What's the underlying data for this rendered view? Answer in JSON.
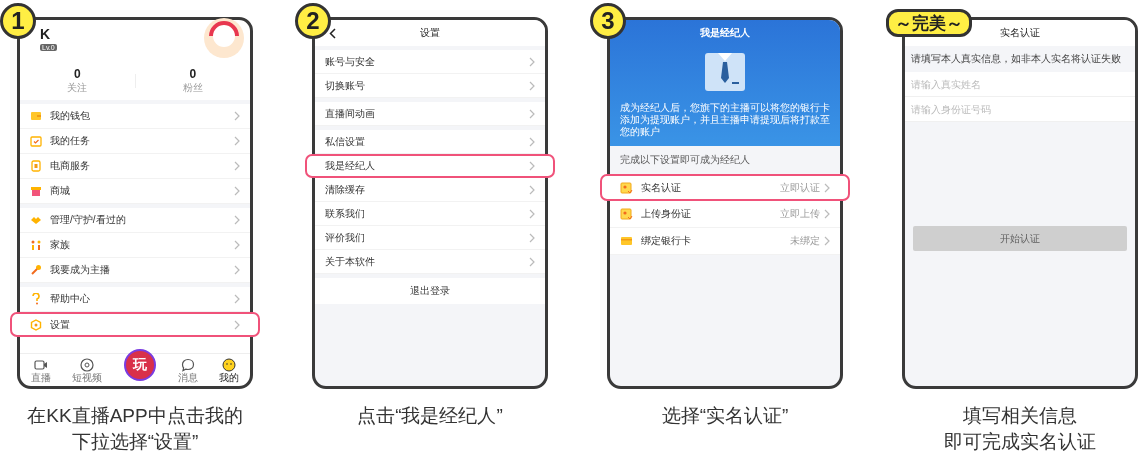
{
  "steps": [
    {
      "badge": {
        "kind": "number",
        "text": "1"
      },
      "screen": {
        "kind": "profile",
        "user": {
          "name": "K",
          "level": "Lv.0"
        },
        "stats": [
          {
            "value": "0",
            "label": "关注"
          },
          {
            "value": "0",
            "label": "粉丝"
          }
        ],
        "menu_groups": [
          [
            {
              "label": "我的钱包",
              "highlighted": false
            },
            {
              "label": "我的任务",
              "highlighted": false
            },
            {
              "label": "电商服务",
              "highlighted": false
            },
            {
              "label": "商城",
              "highlighted": false
            }
          ],
          [
            {
              "label": "管理/守护/看过的",
              "highlighted": false
            },
            {
              "label": "家族",
              "highlighted": false
            },
            {
              "label": "我要成为主播",
              "highlighted": false
            }
          ],
          [
            {
              "label": "帮助中心",
              "highlighted": false
            },
            {
              "label": "设置",
              "highlighted": true
            }
          ]
        ],
        "tab_bar": [
          {
            "kind": "tab",
            "label": "直播",
            "selected": false
          },
          {
            "kind": "tab",
            "label": "短视频",
            "selected": false
          },
          {
            "kind": "center",
            "label": "玩",
            "selected": false
          },
          {
            "kind": "tab",
            "label": "消息",
            "selected": false
          },
          {
            "kind": "tab",
            "label": "我的",
            "selected": true
          }
        ]
      },
      "caption": [
        "在KK直播APP中点击我的",
        "下拉选择“设置”"
      ]
    },
    {
      "badge": {
        "kind": "number",
        "text": "2"
      },
      "screen": {
        "kind": "settings",
        "title": "设置",
        "menu_groups": [
          [
            {
              "label": "账号与安全",
              "highlighted": false
            },
            {
              "label": "切换账号",
              "highlighted": false
            }
          ],
          [
            {
              "label": "直播间动画",
              "highlighted": false
            }
          ],
          [
            {
              "label": "私信设置",
              "highlighted": false
            },
            {
              "label": "我是经纪人",
              "highlighted": true
            },
            {
              "label": "清除缓存",
              "highlighted": false
            },
            {
              "label": "联系我们",
              "highlighted": false
            },
            {
              "label": "评价我们",
              "highlighted": false
            },
            {
              "label": "关于本软件",
              "highlighted": false
            }
          ]
        ],
        "logout": "退出登录"
      },
      "caption": [
        "点击“我是经纪人”"
      ]
    },
    {
      "badge": {
        "kind": "number",
        "text": "3"
      },
      "screen": {
        "kind": "agent",
        "title": "我是经纪人",
        "description": "成为经纪人后，您旗下的主播可以将您的银行卡添加为提现账户，并且主播申请提现后将打款至您的账户",
        "section_label": "完成以下设置即可成为经纪人",
        "tasks": [
          {
            "label": "实名认证",
            "status": "立即认证",
            "highlighted": true
          },
          {
            "label": "上传身份证",
            "status": "立即上传",
            "highlighted": false
          },
          {
            "label": "绑定银行卡",
            "status": "未绑定",
            "highlighted": false
          }
        ]
      },
      "caption": [
        "选择“实名认证”"
      ]
    },
    {
      "badge": {
        "kind": "pill",
        "text": "～完美～"
      },
      "screen": {
        "kind": "verify",
        "title": "实名认证",
        "notice": "请填写本人真实信息，如非本人实名将认证失败",
        "fields": [
          {
            "placeholder": "请输入真实姓名"
          },
          {
            "placeholder": "请输入身份证号码"
          }
        ],
        "submit": {
          "label": "开始认证",
          "disabled": true
        }
      },
      "caption": [
        "填写相关信息",
        "即可完成实名认证"
      ]
    }
  ]
}
